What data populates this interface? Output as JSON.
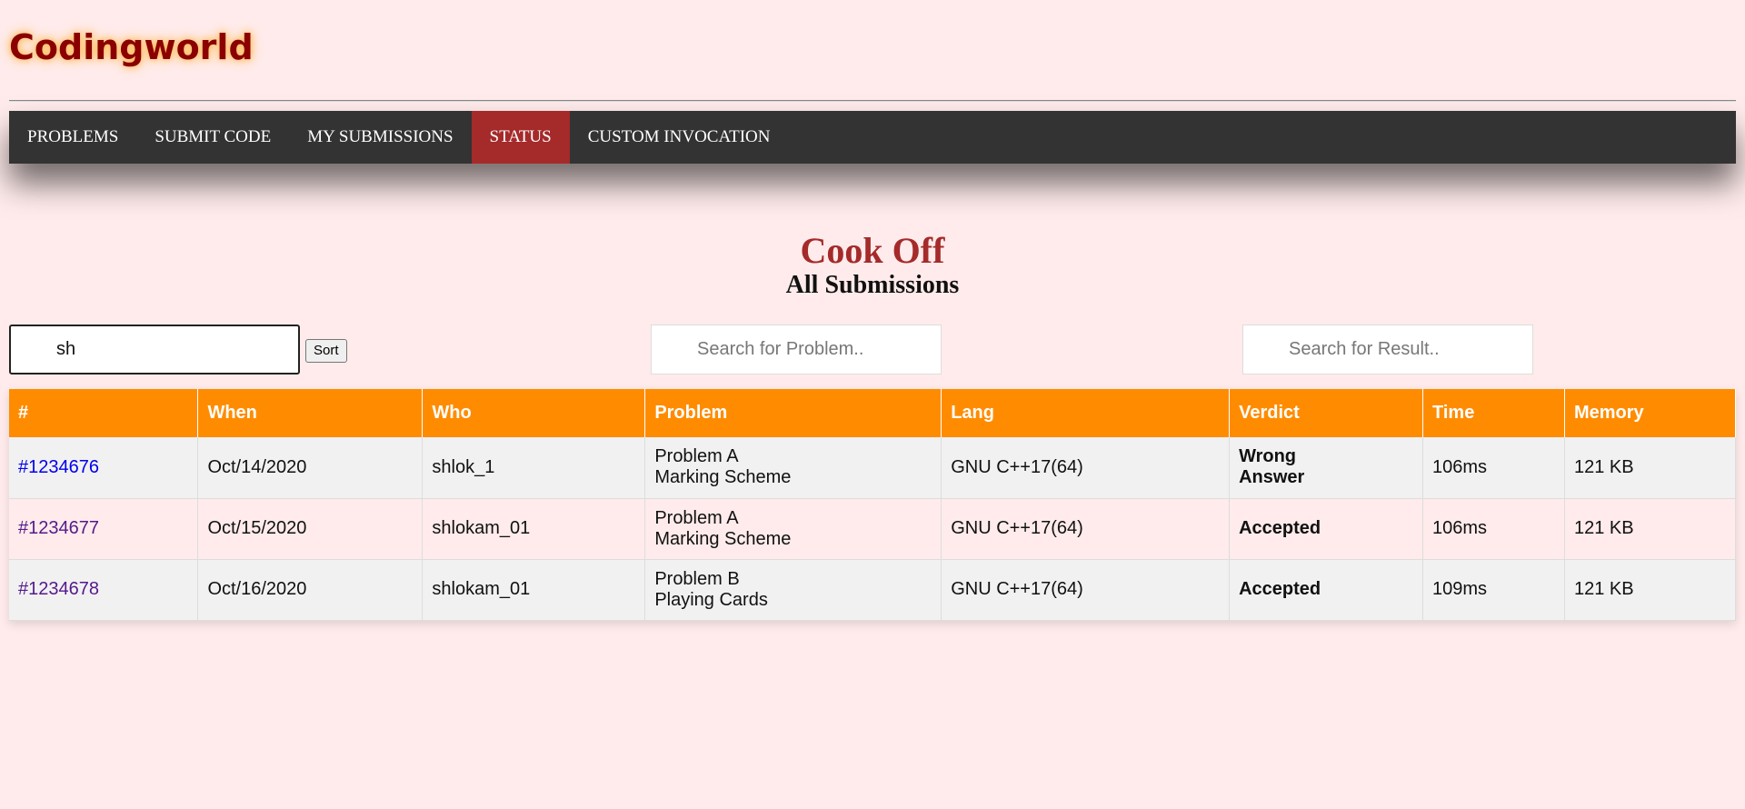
{
  "app": {
    "logo": "Codingworld"
  },
  "nav": {
    "items": [
      {
        "label": "PROBLEMS",
        "active": false
      },
      {
        "label": "SUBMIT CODE",
        "active": false
      },
      {
        "label": "MY SUBMISSIONS",
        "active": false
      },
      {
        "label": "STATUS",
        "active": true
      },
      {
        "label": "CUSTOM INVOCATION",
        "active": false
      }
    ],
    "active_color": "#a52a2a",
    "bar_color": "#333333"
  },
  "page": {
    "title": "Cook Off",
    "subtitle": "All Submissions"
  },
  "filters": {
    "who_value": "sh",
    "sort_label": "Sort",
    "problem_placeholder": "Search for Problem..",
    "result_placeholder": "Search for Result.."
  },
  "table": {
    "header_color": "#ff8c00",
    "columns": [
      "#",
      "When",
      "Who",
      "Problem",
      "Lang",
      "Verdict",
      "Time",
      "Memory"
    ],
    "rows": [
      {
        "id": "#1234676",
        "when": "Oct/14/2020",
        "who": "shlok_1",
        "problem_line1": "Problem A",
        "problem_line2": "Marking Scheme",
        "lang": "GNU C++17(64)",
        "verdict_line1": "Wrong",
        "verdict_line2": "Answer",
        "verdict_status": "wrong",
        "time": "106ms",
        "memory": "121 KB"
      },
      {
        "id": "#1234677",
        "when": "Oct/15/2020",
        "who": "shlokam_01",
        "problem_line1": "Problem A",
        "problem_line2": "Marking Scheme",
        "lang": "GNU C++17(64)",
        "verdict_line1": "Accepted",
        "verdict_line2": "",
        "verdict_status": "accepted",
        "time": "106ms",
        "memory": "121 KB"
      },
      {
        "id": "#1234678",
        "when": "Oct/16/2020",
        "who": "shlokam_01",
        "problem_line1": "Problem B",
        "problem_line2": "Playing Cards",
        "lang": "GNU C++17(64)",
        "verdict_line1": "Accepted",
        "verdict_line2": "",
        "verdict_status": "accepted",
        "time": "109ms",
        "memory": "121 KB"
      }
    ]
  }
}
